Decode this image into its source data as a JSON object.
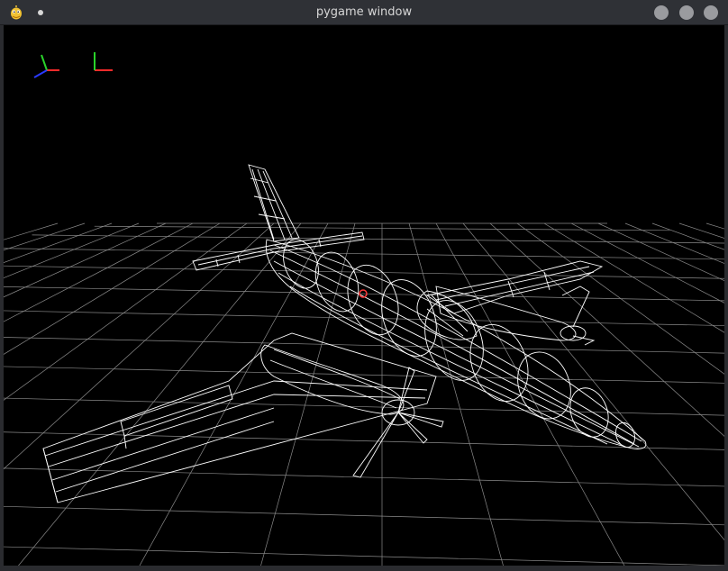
{
  "window": {
    "title": "pygame window",
    "app_icon": "pygame-snake-icon",
    "controls": [
      "minimize-button",
      "maximize-button",
      "close-button"
    ]
  },
  "scene": {
    "background": "#000000",
    "wireframe_color": "#ffffff",
    "grid_color": "#8a8a8a",
    "gizmos": [
      {
        "name": "orientation-gizmo-3d",
        "axes": [
          "x-red",
          "y-green",
          "z-blue"
        ]
      },
      {
        "name": "orientation-gizmo-2d",
        "axes": [
          "x-red",
          "y-green"
        ]
      }
    ],
    "object": "twin-engine-airplane-wireframe",
    "pivot_marker_color": "#ff3b3b"
  }
}
